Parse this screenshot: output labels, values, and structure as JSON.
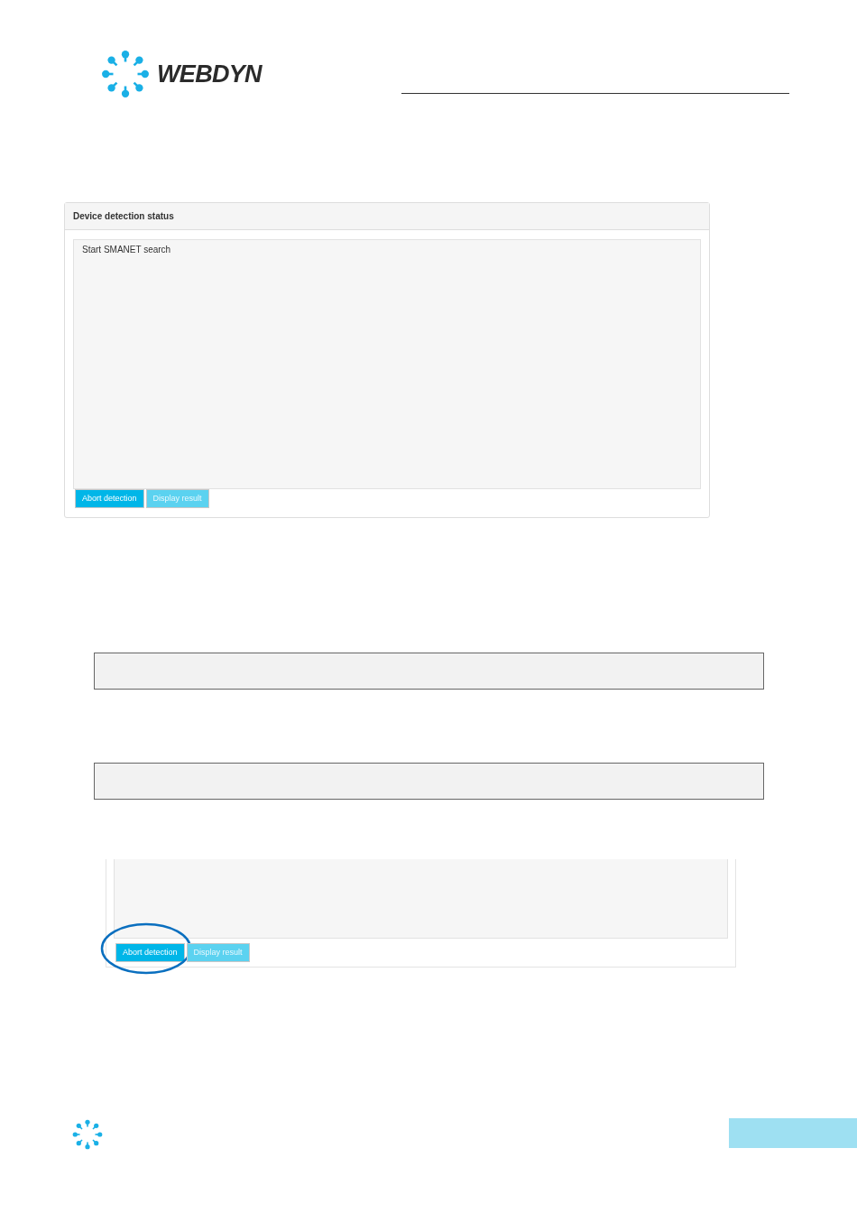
{
  "header": {
    "logo_text": "WEBDYN"
  },
  "panel": {
    "title": "Device detection status",
    "log": "Start SMANET search",
    "buttons": [
      {
        "label": "Abort detection",
        "disabled": false
      },
      {
        "label": "Display result",
        "disabled": true
      }
    ]
  },
  "cropped_panel": {
    "buttons": [
      {
        "label": "Abort detection",
        "disabled": false,
        "highlighted": true
      },
      {
        "label": "Display result",
        "disabled": true,
        "highlighted": false
      }
    ]
  }
}
